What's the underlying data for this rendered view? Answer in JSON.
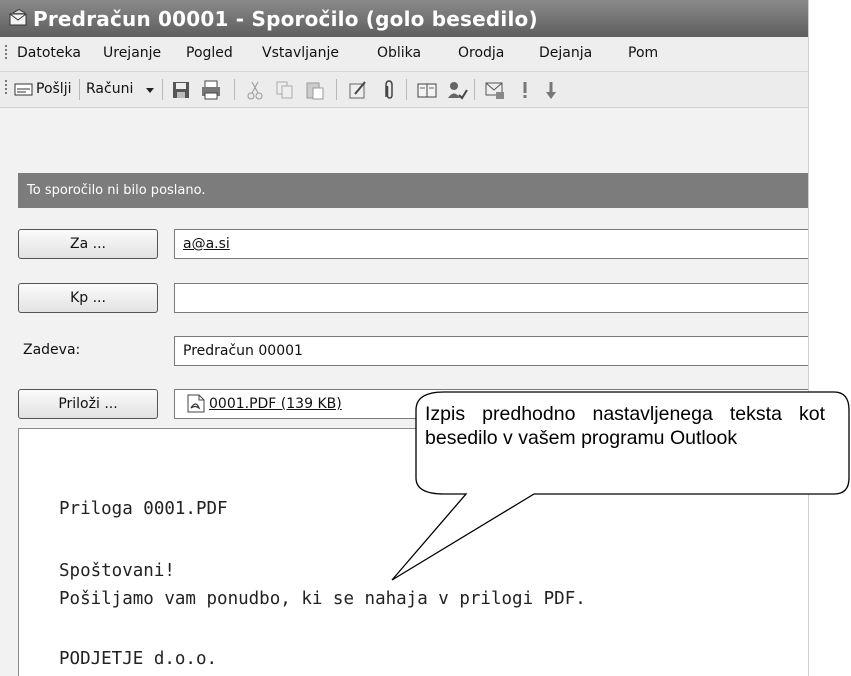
{
  "window": {
    "title": "Predračun 00001 - Sporočilo (golo besedilo)"
  },
  "menu": {
    "items": [
      "Datoteka",
      "Urejanje",
      "Pogled",
      "Vstavljanje",
      "Oblika",
      "Orodja",
      "Dejanja",
      "Pom"
    ]
  },
  "toolbar": {
    "send_label": "Pošlji",
    "accounts_label": "Računi",
    "icons": [
      "save-icon",
      "print-icon",
      "cut-icon",
      "copy-icon",
      "paste-icon",
      "check-names-icon",
      "attach-icon",
      "address-book-icon",
      "check-names-icon",
      "message-options-icon",
      "importance-high-icon",
      "importance-low-icon"
    ]
  },
  "infobar": {
    "text": "To sporočilo ni bilo poslano."
  },
  "header": {
    "to_button": "Za ...",
    "to_value": "a@a.si",
    "cc_button": "Kp ...",
    "cc_value": "",
    "subject_label": "Zadeva:",
    "subject_value": "Predračun 00001",
    "attach_button": "Priloži ...",
    "attachment": "0001.PDF (139 KB)"
  },
  "body": {
    "line1": "Priloga 0001.PDF",
    "line2": "Spoštovani!",
    "line3": "Pošiljamo vam ponudbo, ki se nahaja v prilogi PDF.",
    "line4": "PODJETJE d.o.o."
  },
  "callout": {
    "text": "Izpis predhodno nastavljenega teksta kot besedilo v vašem programu Outlook"
  },
  "colors": {
    "titlebar": "#6e6e6e",
    "infobar": "#7c7c7c",
    "chrome": "#eeeeee"
  }
}
